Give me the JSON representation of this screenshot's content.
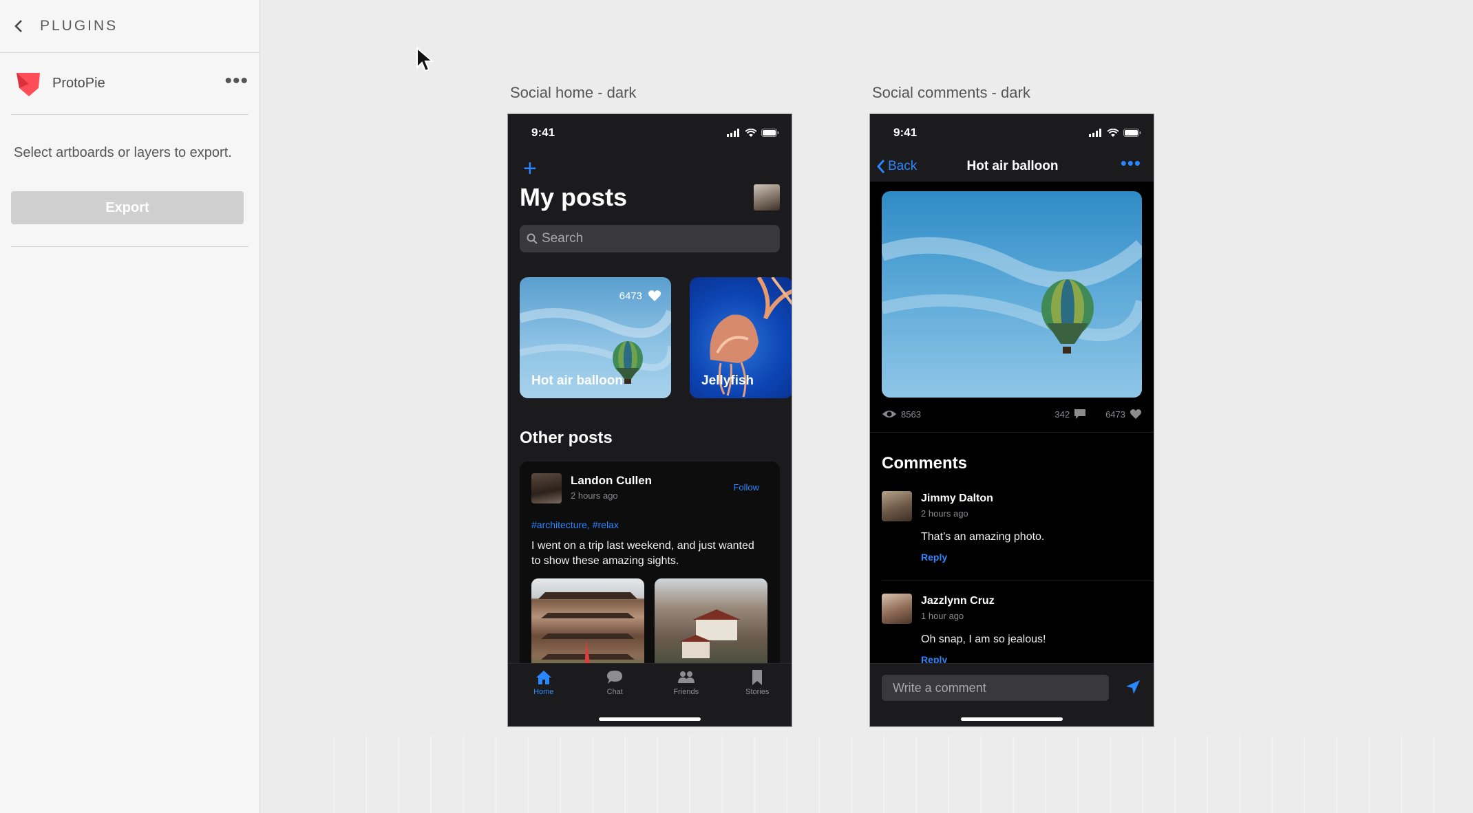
{
  "panel": {
    "title": "PLUGINS",
    "plugin_name": "ProtoPie",
    "more_label": "•••",
    "hint": "Select artboards or layers to export.",
    "export_label": "Export"
  },
  "artboards": {
    "home_label": "Social home - dark",
    "comments_label": "Social comments - dark"
  },
  "home": {
    "time": "9:41",
    "plus": "+",
    "title": "My posts",
    "search_placeholder": "Search",
    "cards": [
      {
        "title": "Hot air balloon",
        "likes": "6473"
      },
      {
        "title": "Jellyfish"
      }
    ],
    "section_title": "Other posts",
    "post": {
      "author": "Landon Cullen",
      "time": "2 hours ago",
      "follow": "Follow",
      "tags": "#architecture, #relax",
      "text": "I went on a trip last weekend, and just wanted to show these amazing sights."
    },
    "tabs": [
      {
        "label": "Home",
        "icon": "home-icon"
      },
      {
        "label": "Chat",
        "icon": "chat-icon"
      },
      {
        "label": "Friends",
        "icon": "friends-icon"
      },
      {
        "label": "Stories",
        "icon": "bookmark-icon"
      }
    ]
  },
  "comments": {
    "time": "9:41",
    "back": "Back",
    "title": "Hot air balloon",
    "views": "8563",
    "comment_count": "342",
    "likes": "6473",
    "section_title": "Comments",
    "items": [
      {
        "name": "Jimmy Dalton",
        "time": "2 hours ago",
        "text": "That’s an amazing photo.",
        "reply": "Reply"
      },
      {
        "name": "Jazzlynn Cruz",
        "time": "1 hour ago",
        "text": "Oh snap, I am so jealous!",
        "reply": "Reply"
      }
    ],
    "input_placeholder": "Write a comment"
  },
  "colors": {
    "accent": "#2b87ff",
    "phone_bg": "#1b1b1d",
    "canvas_bg": "#ececec"
  }
}
